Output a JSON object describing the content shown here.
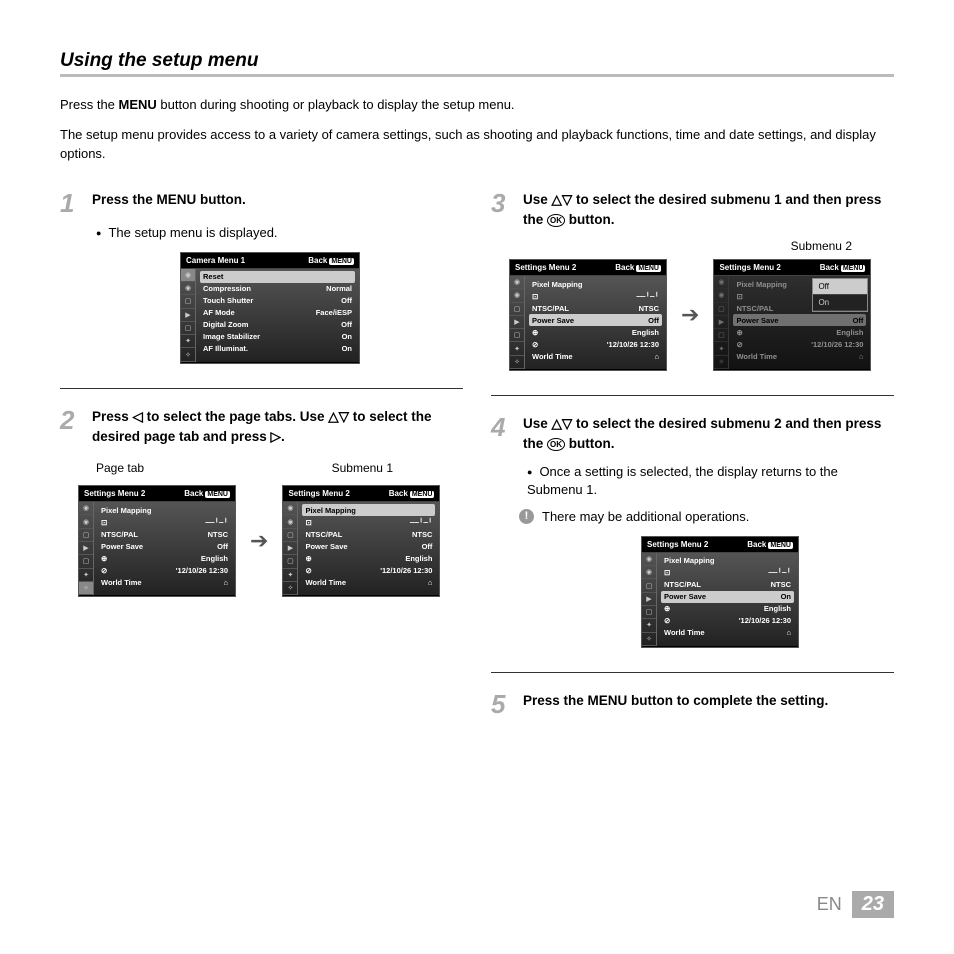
{
  "title": "Using the setup menu",
  "intro1_a": "Press the ",
  "intro1_b": "MENU",
  "intro1_c": " button during shooting or playback to display the setup menu.",
  "intro2": "The setup menu provides access to a variety of camera settings, such as shooting and playback functions, time and date settings, and display options.",
  "step1": {
    "num": "1",
    "text_a": "Press the ",
    "text_b": "MENU",
    "text_c": " button.",
    "bullet": "The setup menu is displayed."
  },
  "step2": {
    "num": "2",
    "text": "Press ◁ to select the page tabs. Use △▽ to select the desired page tab and press ▷."
  },
  "step3": {
    "num": "3",
    "text_a": "Use △▽ to select the desired submenu 1 and then press the ",
    "text_b": " button."
  },
  "step4": {
    "num": "4",
    "text_a": "Use △▽ to select the desired submenu 2 and then press the ",
    "text_b": " button.",
    "bullet": "Once a setting is selected, the display returns to the Submenu 1.",
    "note": "There may be additional operations."
  },
  "step5": {
    "num": "5",
    "text_a": "Press the ",
    "text_b": "MENU",
    "text_c": " button to complete the setting."
  },
  "labels": {
    "page_tab": "Page tab",
    "submenu1": "Submenu 1",
    "submenu2": "Submenu 2"
  },
  "ok": "OK",
  "back": "Back",
  "menu_btn": "MENU",
  "cam1": {
    "title": "Camera Menu 1",
    "rows": [
      {
        "k": "Reset",
        "v": "",
        "hl": true
      },
      {
        "k": "Compression",
        "v": "Normal"
      },
      {
        "k": "Touch Shutter",
        "v": "Off"
      },
      {
        "k": "AF Mode",
        "v": "Face/iESP"
      },
      {
        "k": "Digital Zoom",
        "v": "Off"
      },
      {
        "k": "Image Stabilizer",
        "v": "On"
      },
      {
        "k": "AF Illuminat.",
        "v": "On"
      }
    ],
    "tabs": [
      "◉",
      "◉",
      "▢",
      "▶",
      "▢",
      "✦",
      "✧"
    ]
  },
  "sm2": {
    "title": "Settings Menu 2",
    "rows_a": [
      {
        "k": "Pixel Mapping",
        "v": ""
      },
      {
        "k": "⊡",
        "v": "┄┄╵┄╵"
      },
      {
        "k": "NTSC/PAL",
        "v": "NTSC"
      },
      {
        "k": "Power Save",
        "v": "Off"
      },
      {
        "k": "⊕",
        "v": "English"
      },
      {
        "k": "⊘",
        "v": "'12/10/26 12:30"
      },
      {
        "k": "World Time",
        "v": "⌂"
      }
    ],
    "rows_b": [
      {
        "k": "Pixel Mapping",
        "v": "",
        "hl": true
      },
      {
        "k": "⊡",
        "v": "┄┄╵┄╵"
      },
      {
        "k": "NTSC/PAL",
        "v": "NTSC"
      },
      {
        "k": "Power Save",
        "v": "Off"
      },
      {
        "k": "⊕",
        "v": "English"
      },
      {
        "k": "⊘",
        "v": "'12/10/26 12:30"
      },
      {
        "k": "World Time",
        "v": "⌂"
      }
    ],
    "rows_d": [
      {
        "k": "Pixel Mapping",
        "v": ""
      },
      {
        "k": "⊡",
        "v": "┄┄╵┄╵"
      },
      {
        "k": "NTSC/PAL",
        "v": "NTSC"
      },
      {
        "k": "Power Save",
        "v": "On",
        "hl": true
      },
      {
        "k": "⊕",
        "v": "English"
      },
      {
        "k": "⊘",
        "v": "'12/10/26 12:30"
      },
      {
        "k": "World Time",
        "v": "⌂"
      }
    ],
    "tabs": [
      "◉",
      "◉",
      "▢",
      "▶",
      "▢",
      "✦",
      "✧"
    ],
    "tabs_hl": [
      "◉",
      "◉",
      "▢",
      "▶",
      "▢",
      "✦",
      "✧"
    ]
  },
  "popup": {
    "off": "Off",
    "on": "On"
  },
  "footer": {
    "lang": "EN",
    "page": "23"
  }
}
